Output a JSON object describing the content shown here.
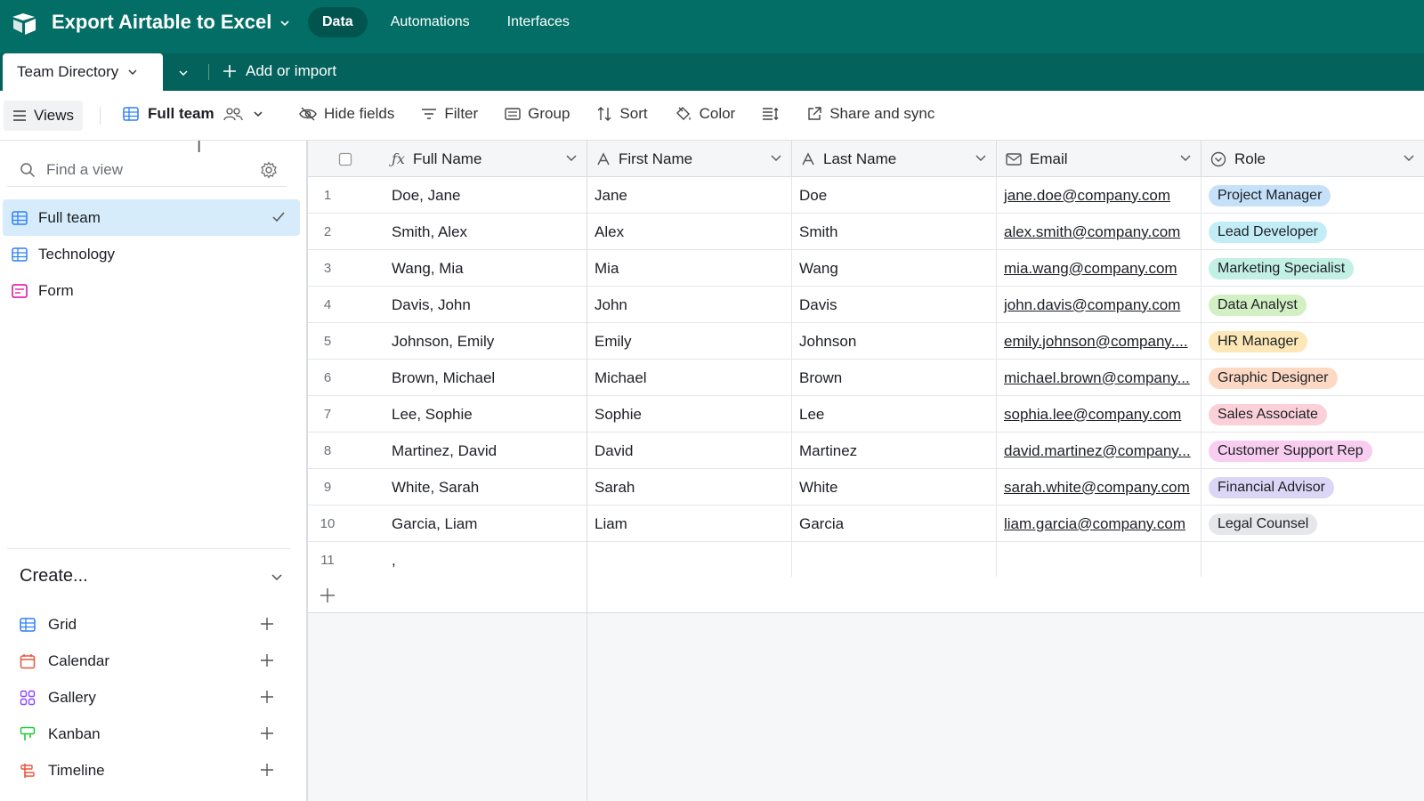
{
  "app": {
    "base_title": "Export Airtable to Excel",
    "nav_tabs": [
      {
        "label": "Data",
        "active": true
      },
      {
        "label": "Automations",
        "active": false
      },
      {
        "label": "Interfaces",
        "active": false
      }
    ],
    "accent": "#036e66"
  },
  "tablebar": {
    "active_table": "Team Directory",
    "add_import": "Add or import"
  },
  "toolbar": {
    "views_label": "Views",
    "current_view": "Full team",
    "actions": {
      "hide_fields": "Hide fields",
      "filter": "Filter",
      "group": "Group",
      "sort": "Sort",
      "color": "Color",
      "share": "Share and sync"
    }
  },
  "sidebar": {
    "search_placeholder": "Find a view",
    "views": [
      {
        "label": "Full team",
        "type": "grid",
        "active": true
      },
      {
        "label": "Technology",
        "type": "grid",
        "active": false
      },
      {
        "label": "Form",
        "type": "form",
        "active": false
      }
    ],
    "create_title": "Create...",
    "create_items": [
      {
        "label": "Grid",
        "icon": "grid-icon"
      },
      {
        "label": "Calendar",
        "icon": "calendar-icon"
      },
      {
        "label": "Gallery",
        "icon": "gallery-icon"
      },
      {
        "label": "Kanban",
        "icon": "kanban-icon"
      },
      {
        "label": "Timeline",
        "icon": "timeline-icon"
      }
    ]
  },
  "grid": {
    "columns": [
      {
        "label": "Full Name",
        "icon": "formula-icon"
      },
      {
        "label": "First Name",
        "icon": "text-icon"
      },
      {
        "label": "Last Name",
        "icon": "text-icon"
      },
      {
        "label": "Email",
        "icon": "email-icon"
      },
      {
        "label": "Role",
        "icon": "single-select-icon"
      }
    ],
    "rows": [
      {
        "n": "1",
        "full": "Doe, Jane",
        "first": "Jane",
        "last": "Doe",
        "email": "jane.doe@company.com",
        "role": "Project Manager",
        "role_color": "#c5e1f9"
      },
      {
        "n": "2",
        "full": "Smith, Alex",
        "first": "Alex",
        "last": "Smith",
        "email": "alex.smith@company.com",
        "role": "Lead Developer",
        "role_color": "#c3edf6"
      },
      {
        "n": "3",
        "full": "Wang, Mia",
        "first": "Mia",
        "last": "Wang",
        "email": "mia.wang@company.com",
        "role": "Marketing Specialist",
        "role_color": "#c2f0e4"
      },
      {
        "n": "4",
        "full": "Davis, John",
        "first": "John",
        "last": "Davis",
        "email": "john.davis@company.com",
        "role": "Data Analyst",
        "role_color": "#d3f0c4"
      },
      {
        "n": "5",
        "full": "Johnson, Emily",
        "first": "Emily",
        "last": "Johnson",
        "email": "emily.johnson@company....",
        "role": "HR Manager",
        "role_color": "#fde7b6"
      },
      {
        "n": "6",
        "full": "Brown, Michael",
        "first": "Michael",
        "last": "Brown",
        "email": "michael.brown@company...",
        "role": "Graphic Designer",
        "role_color": "#fdd9c4"
      },
      {
        "n": "7",
        "full": "Lee, Sophie",
        "first": "Sophie",
        "last": "Lee",
        "email": "sophia.lee@company.com",
        "role": "Sales Associate",
        "role_color": "#fbd0d8"
      },
      {
        "n": "8",
        "full": "Martinez, David",
        "first": "David",
        "last": "Martinez",
        "email": "david.martinez@company...",
        "role": "Customer Support Rep",
        "role_color": "#f8cdf0"
      },
      {
        "n": "9",
        "full": "White, Sarah",
        "first": "Sarah",
        "last": "White",
        "email": "sarah.white@company.com",
        "role": "Financial Advisor",
        "role_color": "#dcd6f6"
      },
      {
        "n": "10",
        "full": "Garcia, Liam",
        "first": "Liam",
        "last": "Garcia",
        "email": "liam.garcia@company.com",
        "role": "Legal Counsel",
        "role_color": "#e5e7ea"
      },
      {
        "n": "11",
        "full": ",",
        "first": "",
        "last": "",
        "email": "",
        "role": "",
        "role_color": ""
      }
    ]
  }
}
